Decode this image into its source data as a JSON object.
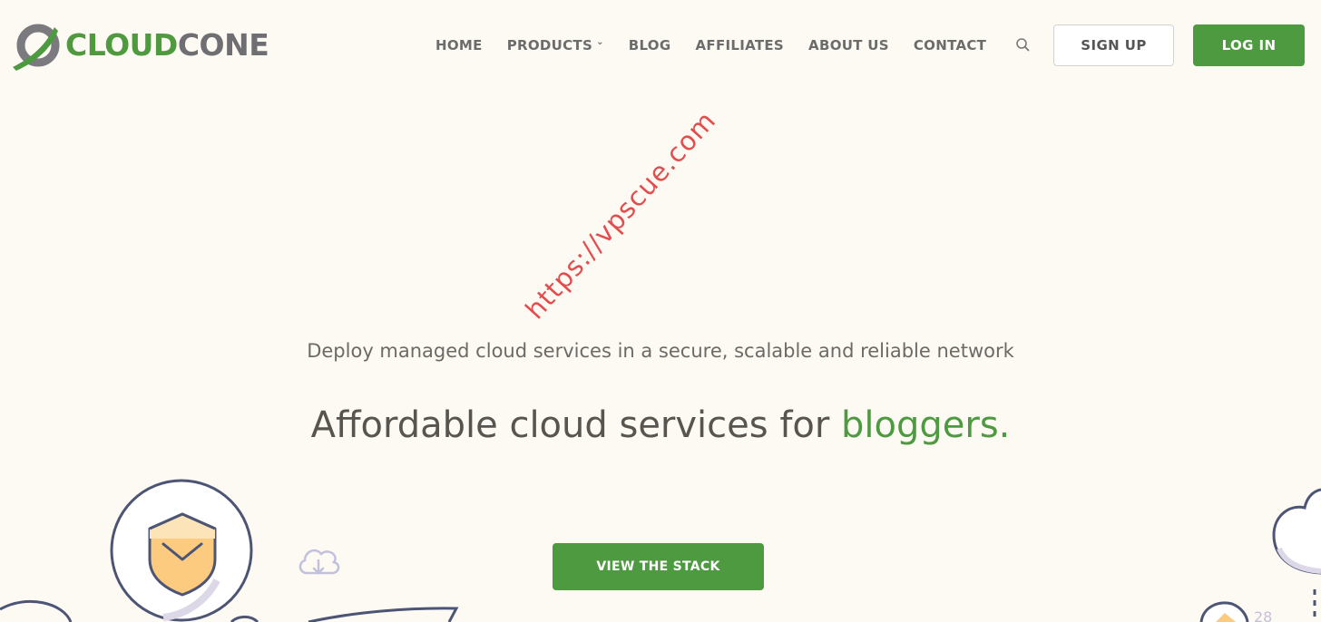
{
  "brand": {
    "name_part1": "CLOUD",
    "name_part2": "CONE",
    "icon": "cloudcone-logo-icon"
  },
  "nav": {
    "items": [
      {
        "label": "HOME"
      },
      {
        "label": "PRODUCTS",
        "icon": "chevron-down-icon",
        "chevron": "⌄"
      },
      {
        "label": "BLOG"
      },
      {
        "label": "AFFILIATES"
      },
      {
        "label": "ABOUT US"
      },
      {
        "label": "CONTACT"
      }
    ],
    "search_icon": "search-icon",
    "signup_label": "SIGN UP",
    "login_label": "LOG IN"
  },
  "hero": {
    "subtitle": "Deploy managed cloud services in a secure, scalable and reliable network",
    "headline_prefix": "Affordable cloud services for ",
    "headline_accent": "bloggers.",
    "cta_label": "VIEW THE STACK"
  },
  "watermark": "https://vpscue.com",
  "colors": {
    "background": "#fdfaf4",
    "brand_green": "#4e9a41",
    "brand_gray": "#6f6f73",
    "text": "#58544f",
    "watermark_red": "#e03b3b"
  },
  "decorations": {
    "shield_icon": "shield-icon",
    "cloud_download_icon": "cloud-download-icon",
    "cloud_icon": "cloud-icon",
    "partial_number": "28"
  }
}
